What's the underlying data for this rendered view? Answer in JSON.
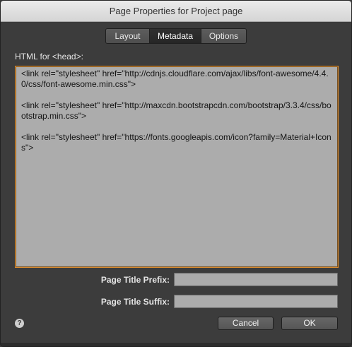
{
  "window": {
    "title": "Page Properties for Project page"
  },
  "tabs": [
    {
      "label": "Layout",
      "active": false
    },
    {
      "label": "Metadata",
      "active": true
    },
    {
      "label": "Options",
      "active": false
    }
  ],
  "head_section": {
    "label": "HTML for <head>:",
    "lines": [
      "<link rel=\"stylesheet\" href=\"http://cdnjs.cloudflare.com/ajax/libs/font-awesome/4.4.0/css/font-awesome.min.css\">",
      "<link rel=\"stylesheet\" href=\"http://maxcdn.bootstrapcdn.com/bootstrap/3.3.4/css/bootstrap.min.css\">",
      "<link rel=\"stylesheet\" href=\"https://fonts.googleapis.com/icon?family=Material+Icons\">"
    ]
  },
  "fields": {
    "title_prefix": {
      "label": "Page Title Prefix:",
      "value": ""
    },
    "title_suffix": {
      "label": "Page Title Suffix:",
      "value": ""
    }
  },
  "footer": {
    "help_glyph": "?",
    "cancel_label": "Cancel",
    "ok_label": "OK"
  },
  "colors": {
    "focus_border": "#d98a2e",
    "field_background": "#acacac",
    "dialog_background": "#3c3c3c"
  }
}
